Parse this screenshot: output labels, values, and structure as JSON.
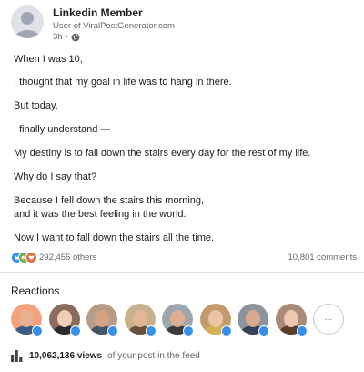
{
  "post": {
    "author_name": "Linkedin Member",
    "author_subtitle": "User of ViralPostGenerator.com",
    "time": "3h •",
    "lines": [
      "When I was 10,",
      "I thought that my goal in life was to hang in there.",
      "But today,",
      "I finally understand —",
      "My destiny is to fall down the stairs every day for the rest of my life.",
      "Why do I say that?",
      "Because I fell down the stairs this morning,",
      "and it was the best feeling in the world.",
      "Now I want to fall down the stairs all the time."
    ]
  },
  "social": {
    "reaction_count": "292,455 others",
    "comment_count": "10,801 comments"
  },
  "reactions": {
    "title": "Reactions",
    "more_label": "...",
    "reactors": [
      {
        "skin": "#e8b08e",
        "shirt": "#3d5a80",
        "bg": "#f4a27d"
      },
      {
        "skin": "#f0cdb5",
        "shirt": "#2b2b2b",
        "bg": "#8a6b5c"
      },
      {
        "skin": "#d7a183",
        "shirt": "#44546a",
        "bg": "#b79c88"
      },
      {
        "skin": "#e2b596",
        "shirt": "#6b4f3a",
        "bg": "#c9b18d"
      },
      {
        "skin": "#dcae94",
        "shirt": "#3a3a3a",
        "bg": "#9fa7ae"
      },
      {
        "skin": "#ebc4a5",
        "shirt": "#d3b355",
        "bg": "#c49a6c"
      },
      {
        "skin": "#d9aa8b",
        "shirt": "#36425a",
        "bg": "#8c949c"
      },
      {
        "skin": "#edc7ae",
        "shirt": "#5b3d2e",
        "bg": "#a98a76"
      }
    ]
  },
  "views": {
    "count": "10,062,136 views",
    "suffix": "of your post in the feed"
  },
  "colors": {
    "like": "#378fe9",
    "celebrate": "#6dae4f",
    "love": "#df704d"
  },
  "icons": [
    "globe-icon",
    "like-reaction-icon",
    "celebrate-reaction-icon",
    "love-reaction-icon",
    "bar-chart-icon"
  ]
}
